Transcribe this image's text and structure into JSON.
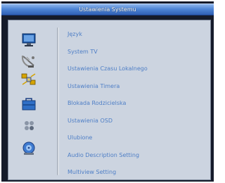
{
  "window": {
    "title": "Ustawienia Systemu"
  },
  "sidebar": {
    "icons": [
      "monitor-icon",
      "satellite-dish-icon",
      "satellite-icon",
      "toolbox-icon",
      "dots-icon",
      "cd-player-icon"
    ]
  },
  "menu": {
    "items": [
      {
        "label": "Język"
      },
      {
        "label": "System TV"
      },
      {
        "label": "Ustawienia Czasu Lokalnego"
      },
      {
        "label": "Ustawienia  Timera"
      },
      {
        "label": "Blokada Rodzicielska"
      },
      {
        "label": "Ustawienia OSD"
      },
      {
        "label": "Ulubione"
      },
      {
        "label": "Audio Description Setting"
      },
      {
        "label": "Multiview Setting"
      }
    ]
  },
  "colors": {
    "title_bar": "#4f86d6",
    "panel": "#ccd4e0",
    "menu_text": "#4f7fc6",
    "frame": "#151b2a"
  }
}
